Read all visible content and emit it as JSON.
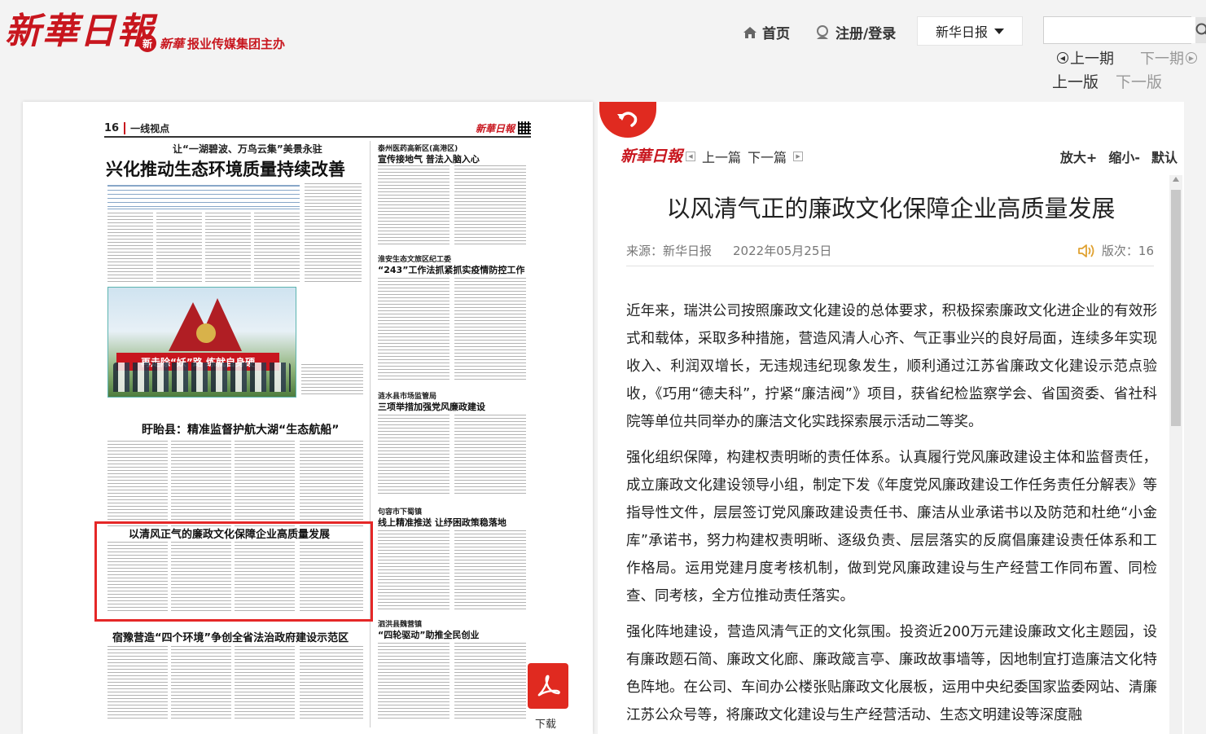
{
  "header": {
    "logo_text": "新華日報",
    "sponsor_badge": "新",
    "sponsor_calli": "新華",
    "sponsor_text": "报业传媒集团主办",
    "nav_home": "首页",
    "nav_login": "注册/登录",
    "paper_select": "新华日报",
    "search_placeholder": "",
    "prev_period": "上一期",
    "next_period": "下一期",
    "prev_edition": "上一版",
    "next_edition": "下一版"
  },
  "paper": {
    "page_number": "16",
    "section": "一线视点",
    "mini_logo": "新華日報",
    "stories": {
      "main_kicker": "让“一湖碧波、万鸟云集”美景永驻",
      "main_headline": "兴化推动生态环境质量持续改善",
      "photo_banner": "再走除“妖”路 练就自身硬",
      "s2_headline": "盱眙县：精准监督护航大湖“生态航船”",
      "s3_headline": "以清风正气的廉政文化保障企业高质量发展",
      "s4_headline": "宿豫营造“四个环境”争创全省法治政府建设示范区",
      "r1_kicker": "泰州医药高新区(高港区)",
      "r1_headline": "宣传接地气 普法入脑入心",
      "r2_kicker": "淮安生态文旅区纪工委",
      "r2_headline": "“243”工作法抓紧抓实疫情防控工作",
      "r3_kicker": "涟水县市场监管局",
      "r3_headline": "三项举措加强党风廉政建设",
      "r4_kicker": "句容市下蜀镇",
      "r4_headline": "线上精准推送 让纾困政策稳落地",
      "r5_kicker": "泗洪县魏营镇",
      "r5_headline": "“四轮驱动”助推全民创业"
    },
    "download_label": "下载"
  },
  "article": {
    "logo": "新華日報",
    "prev_article": "上一篇",
    "next_article": "下一篇",
    "zoom_in": "放大+",
    "zoom_out": "缩小-",
    "zoom_default": "默认",
    "title": "以风清气正的廉政文化保障企业高质量发展",
    "source": "来源：新华日报",
    "date": "2022年05月25日",
    "page_label": "版次：16",
    "paragraphs": [
      "近年来，瑞洪公司按照廉政文化建设的总体要求，积极探索廉政文化进企业的有效形式和载体，采取多种措施，营造风清人心齐、气正事业兴的良好局面，连续多年实现收入、利润双增长，无违规违纪现象发生，顺利通过江苏省廉政文化建设示范点验收，《巧用“德夫科”，拧紧“廉洁阀”》项目，获省纪检监察学会、省国资委、省社科院等单位共同举办的廉洁文化实践探索展示活动二等奖。",
      "强化组织保障，构建权责明晰的责任体系。认真履行党风廉政建设主体和监督责任，成立廉政文化建设领导小组，制定下发《年度党风廉政建设工作任务责任分解表》等指导性文件，层层签订党风廉政建设责任书、廉洁从业承诺书以及防范和杜绝“小金库”承诺书，努力构建权责明晰、逐级负责、层层落实的反腐倡廉建设责任体系和工作格局。运用党建月度考核机制，做到党风廉政建设与生产经营工作同布置、同检查、同考核，全方位推动责任落实。",
      "强化阵地建设，营造风清气正的文化氛围。投资近200万元建设廉政文化主题园，设有廉政题石简、廉政文化廊、廉政箴言亭、廉政故事墙等，因地制宜打造廉洁文化特色阵地。在公司、车间办公楼张贴廉政文化展板，运用中央纪委国家监委网站、清廉江苏公众号等，将廉政文化建设与生产经营活动、生态文明建设等深度融"
    ]
  },
  "colors": {
    "brand_red": "#c8161e",
    "highlight_red": "#e52727",
    "muted_gray": "#999999"
  }
}
